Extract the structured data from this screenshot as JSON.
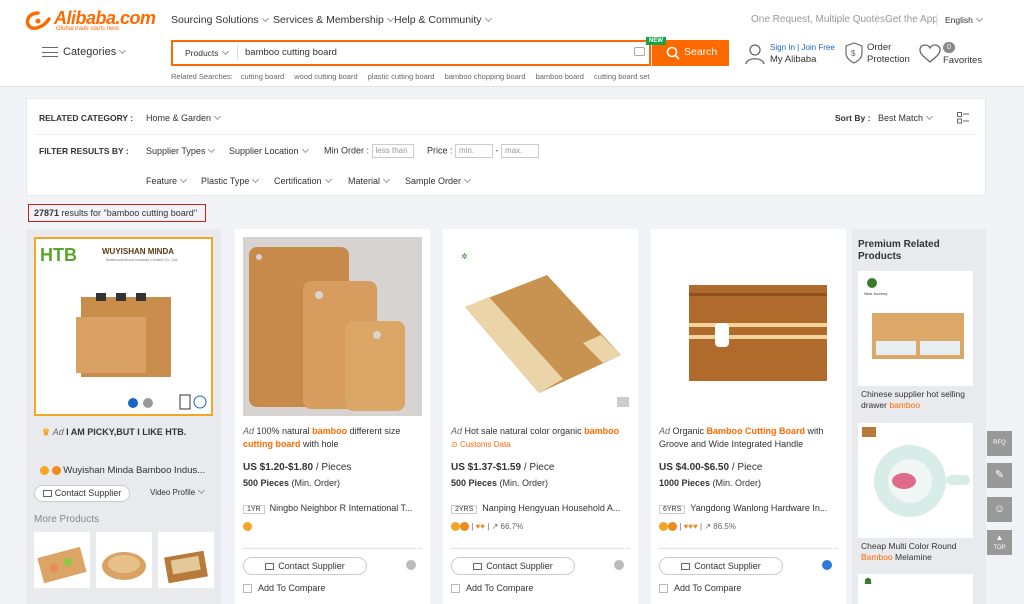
{
  "header": {
    "logo_text": "Alibaba.com",
    "logo_tagline": "Global trade starts here.",
    "nav": [
      "Sourcing Solutions",
      "Services & Membership",
      "Help & Community"
    ],
    "top_right": {
      "quote": "One Request, Multiple Quotes",
      "app": "Get the App",
      "lang": "English"
    },
    "categories_label": "Categories",
    "search": {
      "category": "Products",
      "query": "bamboo cutting board",
      "button": "Search",
      "new_badge": "NEW"
    },
    "related_label": "Related Searches:",
    "related": [
      "cutting board",
      "wood cutting board",
      "plastic cutting board",
      "bamboo chopping board",
      "bamboo board",
      "cutting board set"
    ],
    "user": {
      "sign_in": "Sign In",
      "join": "Join Free",
      "my": "My Alibaba"
    },
    "order": {
      "line1": "Order",
      "line2": "Protection"
    },
    "favorites": {
      "count": "0",
      "label": "Favorites"
    }
  },
  "filter": {
    "related_category_label": "RELATED CATEGORY :",
    "related_category_value": "Home & Garden",
    "sort_label": "Sort By :",
    "sort_value": "Best Match",
    "filter_label": "FILTER RESULTS BY :",
    "supplier_types": "Supplier Types",
    "supplier_location": "Supplier Location",
    "min_order_label": "Min Order :",
    "min_order_placeholder": "less than",
    "price_label": "Price :",
    "price_min_placeholder": "min.",
    "price_max_placeholder": "max.",
    "row3": [
      "Feature",
      "Plastic Type",
      "Certification",
      "Material",
      "Sample Order"
    ]
  },
  "results": {
    "count": "27871",
    "text": "results for \"bamboo cutting board\""
  },
  "supplier_ad": {
    "brand": "HTB",
    "company_banner": "WUYISHAN MINDA",
    "company_sub": "Bamboo&Wood Industry Limited Co.,Ltd",
    "slogan_ad": "Ad",
    "slogan": "I AM PICKY,BUT I LIKE HTB.",
    "company": "Wuyishan Minda Bamboo Indus...",
    "contact": "Contact Supplier",
    "video": "Video Profile",
    "more": "More Products"
  },
  "products": [
    {
      "ad": "Ad",
      "t1": "100% natural ",
      "h1": "bamboo",
      "t2": " different size ",
      "h2": "cutting board",
      "t3": " with hole",
      "price": "US $1.20-$1.80",
      "unit": " / Pieces",
      "moq": "500 Pieces",
      "moq_suffix": " (Min. Order)",
      "yrs": "1YR",
      "supplier": "Ningbo Neighbor R International T...",
      "rate": "",
      "contact": "Contact Supplier",
      "compare": "Add To Compare"
    },
    {
      "ad": "Ad",
      "t1": "Hot sale natural color organic ",
      "h1": "bamboo",
      "t2": "",
      "h2": "",
      "t3": "",
      "tag": "Customs Data",
      "price": "US $1.37-$1.59",
      "unit": " / Piece",
      "moq": "500 Pieces",
      "moq_suffix": " (Min. Order)",
      "yrs": "2YRS",
      "supplier": "Nanping Hengyuan Household A...",
      "rate": "66.7%",
      "contact": "Contact Supplier",
      "compare": "Add To Compare"
    },
    {
      "ad": "Ad",
      "t1": "Organic ",
      "h1": "Bamboo Cutting Board",
      "t2": " with Groove and Wide Integrated Handle",
      "h2": "",
      "t3": "",
      "price": "US $4.00-$6.50",
      "unit": " / Piece",
      "moq": "1000 Pieces",
      "moq_suffix": " (Min. Order)",
      "yrs": "6YRS",
      "supplier": "Yangdong Wanlong Hardware In...",
      "rate": "86.5%",
      "contact": "Contact Supplier",
      "compare": "Add To Compare"
    }
  ],
  "premium": {
    "title": "Premium Related Products",
    "item1_brand": "New Journey",
    "item1": "Chinese supplier hot selling drawer ",
    "item1_hl": "bamboo",
    "item2": "Cheap Multi Color Round ",
    "item2_hl": "Bamboo",
    "item2_tail": " Melamine"
  },
  "right_tools": [
    "RFQ",
    "",
    "",
    "TOP"
  ]
}
